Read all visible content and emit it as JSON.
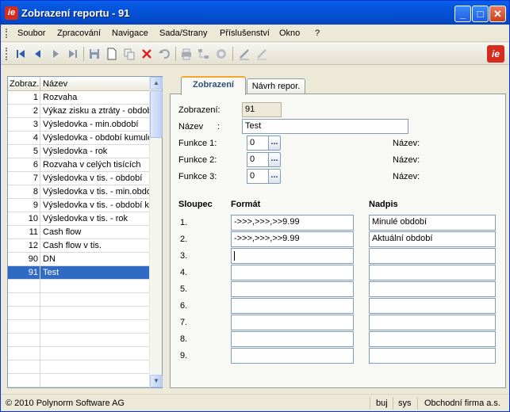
{
  "window": {
    "title": "Zobrazení reportu - 91",
    "logo_text": "ie",
    "controls": {
      "minimize": "_",
      "maximize": "□",
      "close": "✕"
    }
  },
  "menu": {
    "items": [
      "Soubor",
      "Zpracování",
      "Navigace",
      "Sada/Strany",
      "Příslušenství",
      "Okno",
      "?"
    ]
  },
  "toolbar": {
    "icons": [
      "first-icon",
      "prev-icon",
      "next-icon",
      "last-icon",
      "save-icon",
      "new-icon",
      "copy-icon",
      "delete-icon",
      "undo-icon",
      "print-icon",
      "tree-icon",
      "find-icon",
      "edit-icon",
      "edit-disabled-icon"
    ],
    "logo_text": "ie"
  },
  "list": {
    "headers": {
      "code": "Zobraz.",
      "name": "Název"
    },
    "rows": [
      {
        "code": "1",
        "name": "Rozvaha"
      },
      {
        "code": "2",
        "name": "Výkaz zisku a ztráty - obdob"
      },
      {
        "code": "3",
        "name": "Výsledovka - min.období"
      },
      {
        "code": "4",
        "name": "Výsledovka - období kumulc"
      },
      {
        "code": "5",
        "name": "Výsledovka - rok"
      },
      {
        "code": "6",
        "name": "Rozvaha v celých tisících"
      },
      {
        "code": "7",
        "name": "Výsledovka v tis. - období"
      },
      {
        "code": "8",
        "name": "Výsledovka v tis. - min.obdo"
      },
      {
        "code": "9",
        "name": "Výsledovka v tis. - období ku"
      },
      {
        "code": "10",
        "name": "Výsledovka v tis. - rok"
      },
      {
        "code": "11",
        "name": "Cash flow"
      },
      {
        "code": "12",
        "name": "Cash flow v tis."
      },
      {
        "code": "90",
        "name": "DN"
      },
      {
        "code": "91",
        "name": "Test"
      }
    ],
    "selected_code": "91"
  },
  "tabs": [
    "Zobrazení",
    "Návrh repor."
  ],
  "form": {
    "zobrazeni_label": "Zobrazení:",
    "zobrazeni_value": "91",
    "nazev_label": "Název",
    "nazev_colon": ":",
    "nazev_value": "Test",
    "funkce1_label": "Funkce 1:",
    "funkce1_value": "0",
    "funkce2_label": "Funkce 2:",
    "funkce2_value": "0",
    "funkce3_label": "Funkce 3:",
    "funkce3_value": "0",
    "dots": "...",
    "nazev_right_label": "Název:"
  },
  "columns": {
    "sloupec_header": "Sloupec",
    "format_header": "Formát",
    "nadpis_header": "Nadpis",
    "rows": [
      {
        "num": "1.",
        "format": "->>>,>>>,>>9.99",
        "nadpis": "Minulé období"
      },
      {
        "num": "2.",
        "format": "->>>,>>>,>>9.99",
        "nadpis": "Aktuální období"
      },
      {
        "num": "3.",
        "format": "",
        "nadpis": ""
      },
      {
        "num": "4.",
        "format": "",
        "nadpis": ""
      },
      {
        "num": "5.",
        "format": "",
        "nadpis": ""
      },
      {
        "num": "6.",
        "format": "",
        "nadpis": ""
      },
      {
        "num": "7.",
        "format": "",
        "nadpis": ""
      },
      {
        "num": "8.",
        "format": "",
        "nadpis": ""
      },
      {
        "num": "9.",
        "format": "",
        "nadpis": ""
      }
    ]
  },
  "status": {
    "copyright": "© 2010 Polynorm Software AG",
    "user": "buj",
    "db": "sys",
    "company": "Obchodní firma a.s."
  }
}
